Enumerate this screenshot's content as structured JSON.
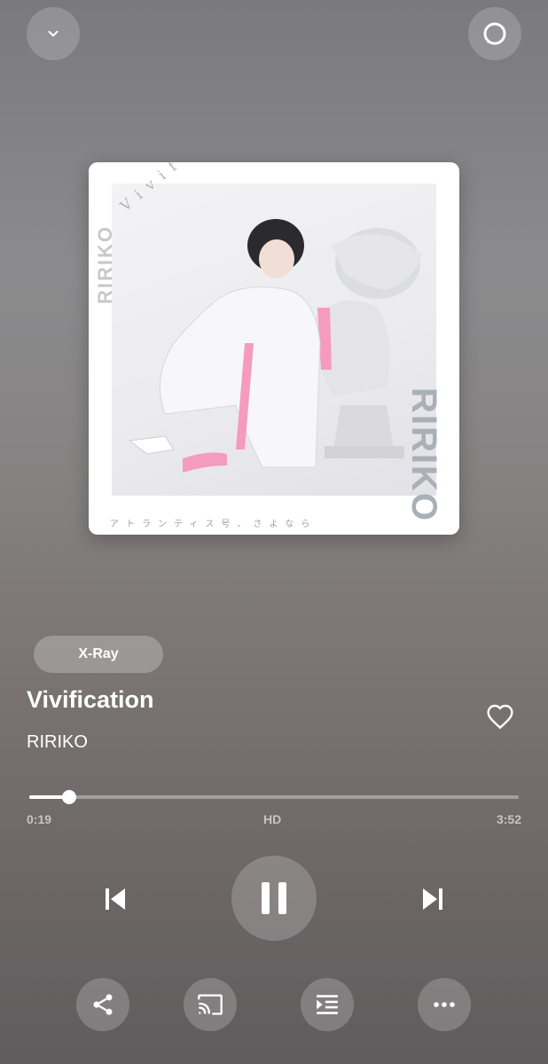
{
  "header": {
    "collapse_icon": "chevron-down-icon",
    "alexa_icon": "alexa-ring-icon"
  },
  "album_art": {
    "side_text": "RIRIKO",
    "big_text": "RIRIKO",
    "arc_text": "Vivification",
    "caption": "アトランティス号、さよなら"
  },
  "xray_label": "X-Ray",
  "track": {
    "title": "Vivification",
    "artist": "RIRIKO",
    "favorite_icon": "heart-outline-icon"
  },
  "progress": {
    "elapsed": "0:19",
    "quality": "HD",
    "total": "3:52",
    "fraction": 0.082
  },
  "controls": {
    "previous_icon": "skip-previous-icon",
    "play_pause_icon": "pause-icon",
    "next_icon": "skip-next-icon"
  },
  "actions": {
    "share_icon": "share-icon",
    "cast_icon": "cast-icon",
    "queue_icon": "queue-icon",
    "more_icon": "more-horizontal-icon"
  },
  "colors": {
    "accent_pink": "#f59bbf",
    "text": "#ffffff"
  }
}
